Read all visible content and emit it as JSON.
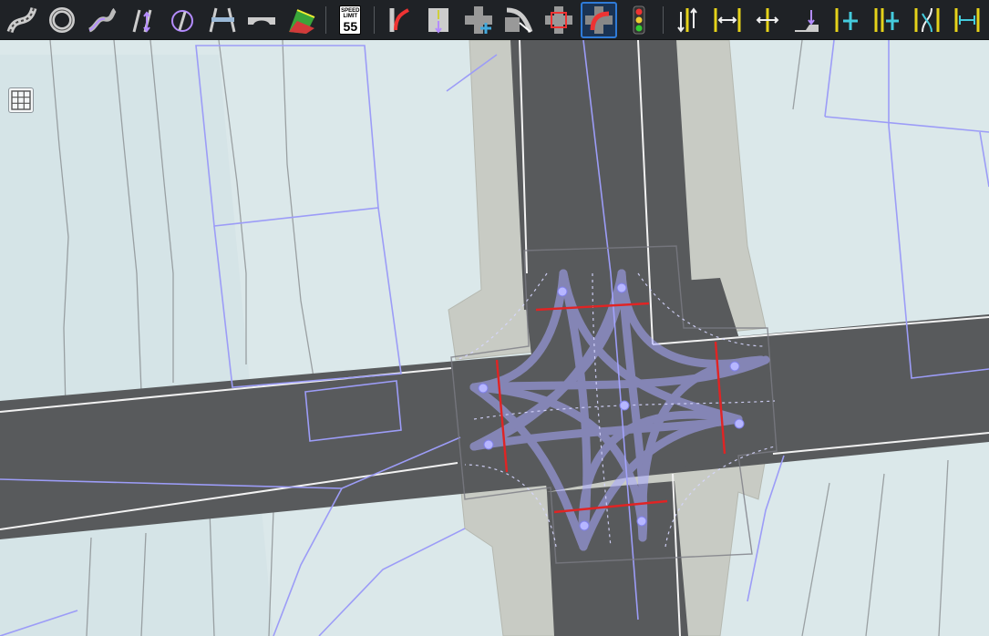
{
  "toolbar": {
    "tools": [
      {
        "id": "road",
        "icon": "road-curve-icon",
        "active": false
      },
      {
        "id": "roundabout",
        "icon": "roundabout-icon",
        "active": false
      },
      {
        "id": "road-freehand",
        "icon": "road-freehand-icon",
        "active": false
      },
      {
        "id": "lane-change",
        "icon": "lane-change-icon",
        "active": false
      },
      {
        "id": "road-rotate",
        "icon": "road-rotate-icon",
        "active": false
      },
      {
        "id": "crosswalk",
        "icon": "crosswalk-icon",
        "active": false
      },
      {
        "id": "bridge",
        "icon": "bridge-icon",
        "active": false
      },
      {
        "id": "terrain-paint",
        "icon": "terrain-paint-icon",
        "active": false
      },
      {
        "id": "speed-limit",
        "icon": "speed-limit-icon",
        "active": false
      },
      {
        "id": "road-connect",
        "icon": "road-connect-icon",
        "active": false
      },
      {
        "id": "lane-merge",
        "icon": "lane-merge-icon",
        "active": false
      },
      {
        "id": "junction-add",
        "icon": "junction-add-icon",
        "active": false
      },
      {
        "id": "junction-turn",
        "icon": "junction-turn-icon",
        "active": false
      },
      {
        "id": "junction-boundary",
        "icon": "junction-boundary-icon",
        "active": false
      },
      {
        "id": "junction-corner",
        "icon": "junction-corner-icon",
        "active": true
      },
      {
        "id": "traffic-signal",
        "icon": "traffic-light-icon",
        "active": false
      },
      {
        "id": "lane-direction",
        "icon": "lane-direction-icon",
        "active": false
      },
      {
        "id": "lane-width",
        "icon": "lane-width-icon",
        "active": false
      },
      {
        "id": "lane-resize",
        "icon": "lane-resize-icon",
        "active": false
      },
      {
        "id": "lane-offset",
        "icon": "lane-offset-icon",
        "active": false
      },
      {
        "id": "lane-add",
        "icon": "lane-add-icon",
        "active": false
      },
      {
        "id": "lane-insert",
        "icon": "lane-insert-icon",
        "active": false
      },
      {
        "id": "lane-split",
        "icon": "lane-split-icon",
        "active": false
      },
      {
        "id": "lane-measure",
        "icon": "lane-measure-icon",
        "active": false
      }
    ],
    "speed_sign": {
      "caption": "SPEED LIMIT",
      "value": "55"
    }
  },
  "viewport": {
    "grid_toggle_icon": "grid-icon",
    "colors": {
      "terrain": "#dbe8ea",
      "asphalt": "#585a5c",
      "sidewalk": "#c9ccc5",
      "lane_marking": "#f2f2f2",
      "overlay_lines": "#9c9cf7",
      "connection_lanes": "#a8a8ff",
      "junction_stop_lines": "#e02424"
    }
  }
}
